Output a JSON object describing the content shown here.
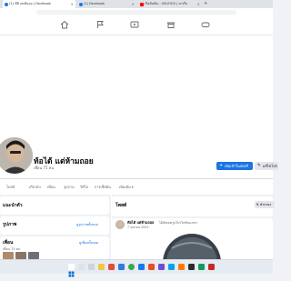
{
  "browser": {
    "tabs": [
      {
        "label": "(1) ห้ยิ แตห้นออ | Facebook",
        "active": true,
        "favicon_color": "#1877f2"
      },
      {
        "label": "(1) Facebook",
        "active": false,
        "favicon_color": "#1877f2"
      },
      {
        "label": "เรือต้นทัน - SULEIOS | หาเรือ",
        "active": false,
        "favicon_color": "#ff0000"
      }
    ],
    "new_tab": "+",
    "close_glyph": "×"
  },
  "profile": {
    "name": "ท้อได้ แต่ห้ามถอย",
    "friends": "เพื่อน 75 คน",
    "add_story_label": "เพิ่มเข้าในสตอรี่",
    "edit_label": "แก้ไขโปร"
  },
  "profile_tabs": [
    "โพสต์",
    "เกี่ยวกับ",
    "เพื่อน",
    "รูปภาพ",
    "วิดีโอ",
    "การเช็คอิน",
    "เพิ่มเติม ▾"
  ],
  "left_column": {
    "card1_title": "แนะนำตัว",
    "card2_title": "รูปภาพ",
    "card2_link": "ดูรูปภาพทั้งหมด",
    "card3_title": "เพื่อน",
    "card3_link": "ดูเพื่อนทั้งหมด",
    "card3_sub": "เพื่อน 75 คน"
  },
  "right_column": {
    "posts_title": "โพสต์",
    "filter_label": "ตัวกรอง",
    "post_author": "ท้อได้ แต่ห้ามถอย",
    "post_action": "ได้อัพเดตรูปโปรไฟล์ของเขา",
    "post_date": "7 เมษายน 2023 ·"
  },
  "colors": {
    "fb_blue": "#1b74e4",
    "bg": "#f0f2f5"
  }
}
